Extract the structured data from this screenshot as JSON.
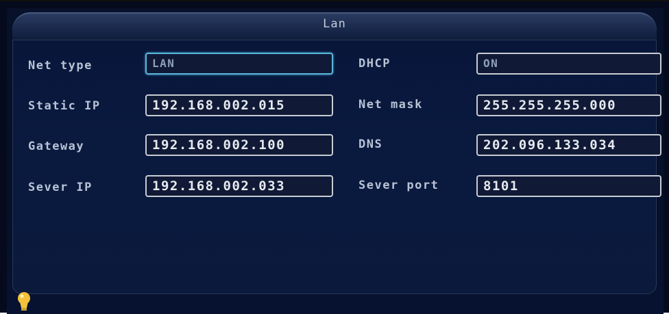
{
  "window": {
    "title": "Lan"
  },
  "fields": {
    "net_type": {
      "label": "Net type",
      "value": "LAN"
    },
    "dhcp": {
      "label": "DHCP",
      "value": "ON"
    },
    "static_ip": {
      "label": "Static IP",
      "value": "192.168.002.015"
    },
    "net_mask": {
      "label": "Net mask",
      "value": "255.255.255.000"
    },
    "gateway": {
      "label": "Gateway",
      "value": "192.168.002.100"
    },
    "dns": {
      "label": "DNS",
      "value": "202.096.133.034"
    },
    "server_ip": {
      "label": "Sever IP",
      "value": "192.168.002.033"
    },
    "server_port": {
      "label": "Sever port",
      "value": "8101"
    }
  },
  "status": {
    "icon": "lightbulb-icon"
  },
  "colors": {
    "background": "#07112a",
    "field_border": "#c9ccd3",
    "selected_border": "#59b7dc",
    "label": "#b9c3d6",
    "bulb": "#f3c23c"
  }
}
